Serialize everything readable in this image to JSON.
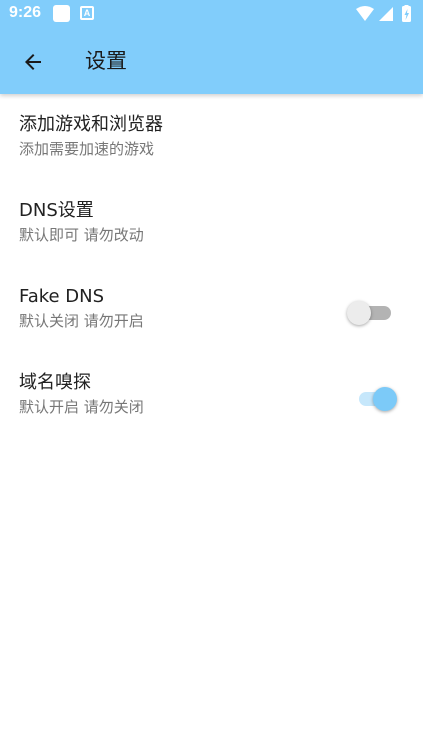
{
  "status_bar": {
    "time": "9:26",
    "left_icons": [
      "notification-square-icon",
      "keyboard-a-icon"
    ],
    "right_icons": [
      "wifi-icon",
      "signal-icon",
      "battery-icon"
    ]
  },
  "app_bar": {
    "back_icon": "arrow-left-icon",
    "title": "设置",
    "background_color": "#81cdfb"
  },
  "settings": {
    "items": [
      {
        "title": "添加游戏和浏览器",
        "subtitle": "添加需要加速的游戏"
      },
      {
        "title": "DNS设置",
        "subtitle": "默认即可 请勿改动"
      },
      {
        "title": "Fake DNS",
        "subtitle": "默认关闭 请勿开启",
        "toggle": false
      },
      {
        "title": "域名嗅探",
        "subtitle": "默认开启 请勿关闭",
        "toggle": true
      }
    ]
  },
  "colors": {
    "accent": "#7ccaf8",
    "toggle_on_track": "#c6e7fb",
    "toggle_off_track": "#b3b3b3",
    "toggle_off_thumb": "#ececec"
  }
}
